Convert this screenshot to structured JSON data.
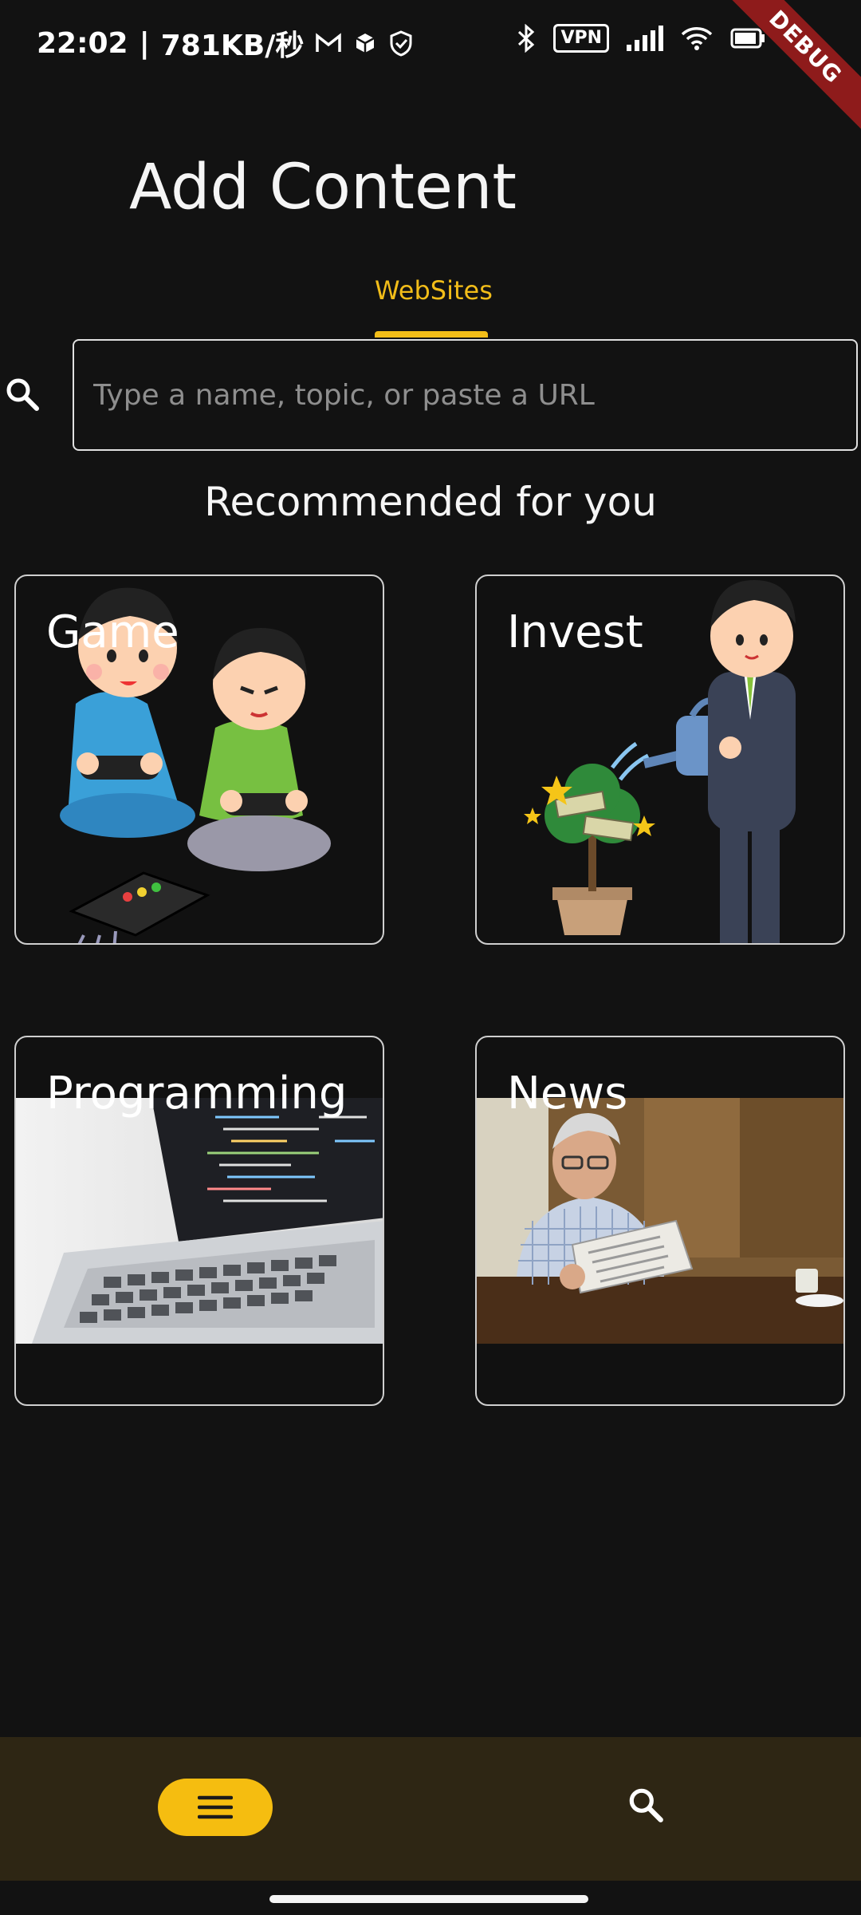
{
  "status_bar": {
    "time": "22:02",
    "separator": "|",
    "network_speed": "781KB/秒",
    "vpn_label": "VPN",
    "icons": [
      "gmail-icon",
      "box-icon",
      "shield-check-icon",
      "bluetooth-icon",
      "vpn-icon",
      "signal-icon",
      "wifi-icon",
      "battery-icon"
    ]
  },
  "debug_banner": "DEBUG",
  "header": {
    "title": "Add Content"
  },
  "tabs": [
    {
      "label": "WebSites",
      "active": true
    }
  ],
  "search": {
    "placeholder": "Type a name, topic, or paste a URL",
    "value": ""
  },
  "section": {
    "title": "Recommended for you"
  },
  "cards": [
    {
      "label": "Game"
    },
    {
      "label": "Invest"
    },
    {
      "label": "Programming"
    },
    {
      "label": "News"
    }
  ],
  "bottom_nav": {
    "items": [
      "menu-icon",
      "search-icon"
    ]
  },
  "colors": {
    "accent": "#f2bd19",
    "background": "#121212",
    "nav_bg": "#2e2614"
  }
}
